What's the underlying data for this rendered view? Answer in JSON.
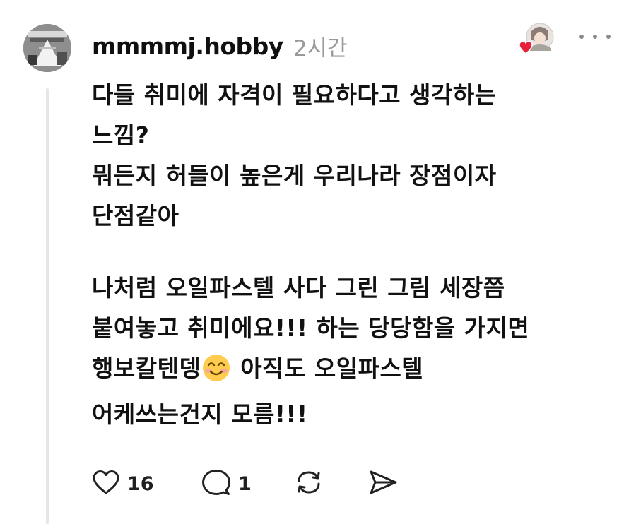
{
  "post": {
    "username": "mmmmj.hobby",
    "time": "2시간",
    "paragraphs": [
      [
        "다들 취미에 자격이 필요하다고 생각하는",
        "느낌?",
        "뭐든지 허들이 높은게 우리나라 장점이자",
        "단점같아"
      ],
      [
        "나처럼 오일파스텔 사다 그린 그림 세장쯤",
        "붙여놓고 취미에요!!! 하는 당당함을 가지면",
        "행보칼텐뎅",
        "어케쓰는건지 모름!!!"
      ]
    ],
    "line3_after_emoji": " 아직도 오일파스텔",
    "emoji": "smiling-face-icon"
  },
  "actions": {
    "like_count": "16",
    "reply_count": "1"
  },
  "colors": {
    "text": "#111111",
    "muted": "#9a9a9a",
    "heart_red": "#e8213a",
    "thread_line": "#e6e6e6"
  }
}
